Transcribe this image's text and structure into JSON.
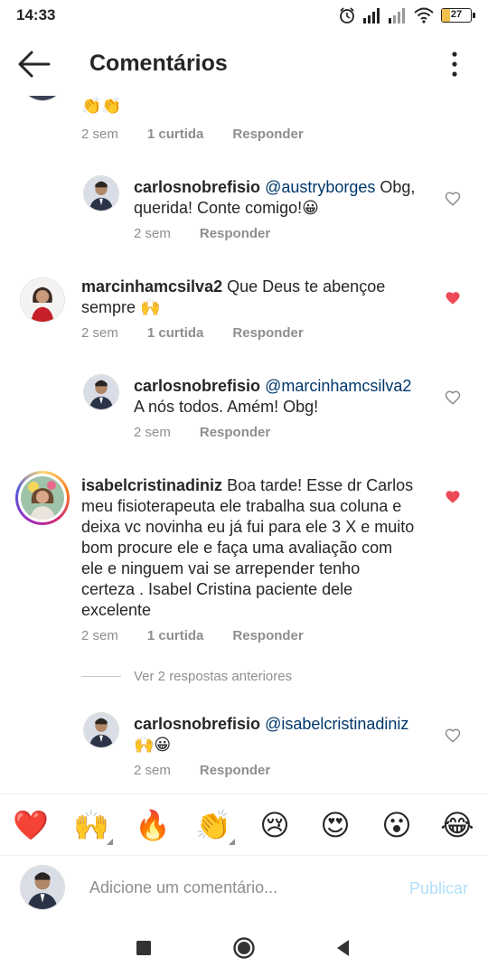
{
  "status_bar": {
    "time": "14:33",
    "battery_level": "27",
    "icons": [
      "alarm-icon",
      "signal-icon",
      "signal-icon",
      "wifi-icon",
      "battery-icon"
    ]
  },
  "header": {
    "title": "Comentários",
    "back_icon": "arrow-left-icon",
    "menu_icon": "more-vertical-icon"
  },
  "comments": [
    {
      "user": "",
      "text": "👏👏",
      "time": "2 sem",
      "likes": "1 curtida",
      "reply": "Responder"
    },
    {
      "user": "carlosnobrefisio",
      "mention": "@austryborges",
      "text": " Obg, querida! Conte comigo!😀",
      "time": "2 sem",
      "reply": "Responder",
      "liked": false
    },
    {
      "user": "marcinhamcsilva2",
      "text": " Que Deus te abençoe sempre 🙌",
      "time": "2 sem",
      "likes": "1 curtida",
      "reply": "Responder",
      "liked": true
    },
    {
      "user": "carlosnobrefisio",
      "mention": "@marcinhamcsilva2",
      "text": "A nós todos. Amém! Obg!",
      "time": "2 sem",
      "reply": "Responder",
      "liked": false
    },
    {
      "user": "isabelcristinadiniz",
      "text": " Boa tarde! Esse  dr Carlos meu fisioterapeuta ele trabalha sua coluna e deixa vc novinha eu já fui para ele 3 X e muito  bom procure ele e faça uma avaliação com ele e ninguem vai se arrepender tenho certeza . Isabel Cristina paciente dele excelente",
      "time": "2 sem",
      "likes": "1 curtida",
      "reply": "Responder",
      "liked": true
    },
    {
      "user": "carlosnobrefisio",
      "mention": "@isabelcristinadiniz",
      "text": "🙌😀",
      "time": "2 sem",
      "reply": "Responder",
      "liked": false
    }
  ],
  "view_more": "Ver 2 respostas anteriores",
  "emoji_bar": [
    "❤️",
    "🙌",
    "🔥",
    "👏",
    "😢",
    "😍",
    "😮",
    "😂"
  ],
  "composer": {
    "placeholder": "Adicione um comentário...",
    "publish": "Publicar"
  },
  "colors": {
    "like_red": "#ed4956",
    "mention_blue": "#00376b",
    "publish_disabled": "#b2dffc",
    "meta_gray": "#8e8e8e"
  }
}
